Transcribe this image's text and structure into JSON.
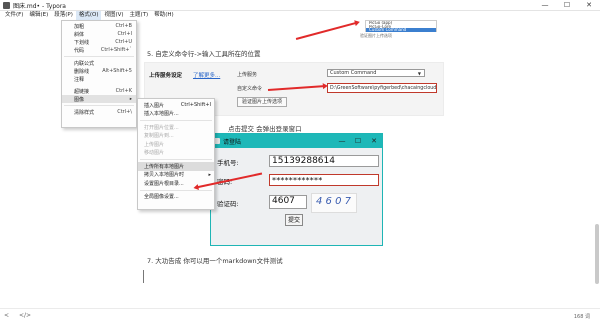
{
  "window": {
    "title": "图床.md• - Typora",
    "controls": [
      "—",
      "☐",
      "✕"
    ]
  },
  "menubar": [
    "文件(F)",
    "编辑(E)",
    "段落(P)",
    "格式(O)",
    "视图(V)",
    "主题(T)",
    "帮助(H)"
  ],
  "format_menu": [
    {
      "label": "加粗",
      "shortcut": "Ctrl+B"
    },
    {
      "label": "斜体",
      "shortcut": "Ctrl+I"
    },
    {
      "label": "下划线",
      "shortcut": "Ctrl+U"
    },
    {
      "label": "代码",
      "shortcut": "Ctrl+Shift+`"
    },
    {
      "label": "内联公式",
      "shortcut": ""
    },
    {
      "label": "删除线",
      "shortcut": "Alt+Shift+5"
    },
    {
      "label": "注释",
      "shortcut": ""
    },
    {
      "label": "超链接",
      "shortcut": "Ctrl+K"
    },
    {
      "label": "图像",
      "shortcut": "▸"
    },
    {
      "label": "清除样式",
      "shortcut": "Ctrl+\\"
    }
  ],
  "image_submenu": [
    {
      "label": "插入图片",
      "shortcut": "Ctrl+Shift+I",
      "disabled": false
    },
    {
      "label": "插入本地图片...",
      "shortcut": "",
      "disabled": false
    },
    {
      "label": "打开图片位置...",
      "shortcut": "",
      "disabled": true
    },
    {
      "label": "复制图片到...",
      "shortcut": "",
      "disabled": true
    },
    {
      "label": "上传图片",
      "shortcut": "",
      "disabled": true
    },
    {
      "label": "移动图片",
      "shortcut": "",
      "disabled": true
    },
    {
      "label": "上传所有本地图片",
      "shortcut": "",
      "disabled": false
    },
    {
      "label": "拷贝入本地图片时",
      "shortcut": "▸",
      "disabled": false
    },
    {
      "label": "设置图片根目录...",
      "shortcut": "",
      "disabled": false
    },
    {
      "label": "全局图像设置...",
      "shortcut": "",
      "disabled": false
    }
  ],
  "doc": {
    "heading5": "5. 自定义命令行->输入工具所在的位置",
    "heading6": "点击提交 会弹出登录窗口",
    "heading7": "7. 大功告成 你可以用一个markdown文件测试",
    "top_menu": [
      "PicGo (app)",
      "PicGo-Core",
      "Custom Command"
    ],
    "top_menu_caption": "验证图片上传选项"
  },
  "upload_panel": {
    "title": "上传服务设定",
    "link": "了解更多...",
    "service_label": "上传服务",
    "service_value": "Custom Command",
    "command_label": "自定义命令",
    "command_value": "D:\\GreenSoftware\\pyfigerbed\\chacaingcloud.exe",
    "verify_button": "验证图片上传选项"
  },
  "login_dialog": {
    "title": "请登陆",
    "controls": [
      "—",
      "☐",
      "✕"
    ],
    "phone_label": "手机号:",
    "phone_value": "15139288614",
    "password_label": "密码:",
    "password_value": "************",
    "code_label": "验证码:",
    "code_value": "4607",
    "captcha_text": "4 6 0 7",
    "submit_label": "提交"
  },
  "status": {
    "left_icons": [
      "<",
      "</>"
    ],
    "word_count": "168 词"
  },
  "colors": {
    "annotation_arrow": "#e12a2a",
    "dialog_titlebar": "#1db8b8",
    "link": "#2a66c9",
    "menu_highlight": "#dbe8f6"
  }
}
